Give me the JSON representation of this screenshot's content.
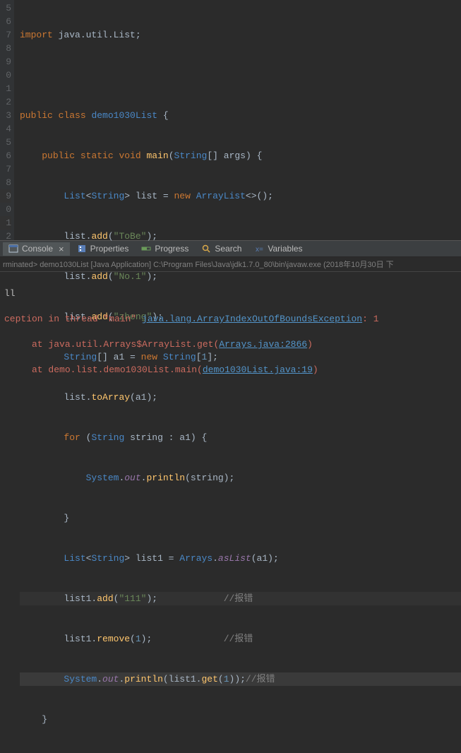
{
  "gutter": {
    "lines": [
      "5",
      "6",
      "7",
      "8",
      "9",
      "0",
      "1",
      "2",
      "3",
      "4",
      "5",
      "6",
      "7",
      "8",
      "9",
      "0",
      "1",
      "2"
    ],
    "breakpoint_line_index": 3
  },
  "code": {
    "l5": {
      "kw1": "import",
      "pkg": " java.util.List;"
    },
    "l7": {
      "kw1": "public",
      "kw2": "class",
      "name": "demo1030List",
      "brace": " {"
    },
    "l8": {
      "kw1": "public",
      "kw2": "static",
      "kw3": "void",
      "met": "main",
      "p1": "(",
      "cls": "String",
      "arr": "[] ",
      "arg": "args",
      "p2": ") {"
    },
    "l9": {
      "cls1": "List",
      "lt": "<",
      "cls2": "String",
      "gt": "> ",
      "var": "list = ",
      "kw": "new",
      "sp": " ",
      "cls3": "ArrayList",
      "diamond": "<>();"
    },
    "l10": {
      "obj": "list.",
      "met": "add",
      "p1": "(",
      "str": "\"ToBe\"",
      "p2": ");"
    },
    "l11": {
      "obj": "list.",
      "met": "add",
      "p1": "(",
      "str": "\"No.1\"",
      "p2": ");"
    },
    "l12": {
      "obj": "list.",
      "met": "add",
      "p1": "(",
      "str": "\"zheng\"",
      "p2": ");"
    },
    "l13": {
      "cls": "String",
      "arr": "[] ",
      "var": "a1 = ",
      "kw": "new",
      "sp": " ",
      "cls2": "String",
      "br1": "[",
      "num": "1",
      "br2": "];"
    },
    "l14": {
      "obj": "list.",
      "met": "toArray",
      "p": "(a1);"
    },
    "l15": {
      "kw": "for",
      "p1": " (",
      "cls": "String",
      "sp": " ",
      "var": "string : a1) {"
    },
    "l16": {
      "cls": "System",
      "dot1": ".",
      "fld": "out",
      "dot2": ".",
      "met": "println",
      "p": "(string);"
    },
    "l17": {
      "brace": "}"
    },
    "l18": {
      "cls1": "List",
      "lt": "<",
      "cls2": "String",
      "gt": "> ",
      "var": "list1 = ",
      "cls3": "Arrays",
      "dot": ".",
      "fld": "asList",
      "p": "(a1);"
    },
    "l19": {
      "obj": "list1.",
      "met": "add",
      "p1": "(",
      "str": "\"111\"",
      "p2": ");",
      "pad": "            ",
      "cmt": "//报错"
    },
    "l20": {
      "obj": "list1.",
      "met": "remove",
      "p1": "(",
      "num": "1",
      "p2": ");",
      "pad": "             ",
      "cmt": "//报错"
    },
    "l21": {
      "cls": "System",
      "dot1": ".",
      "fld": "out",
      "dot2": ".",
      "met": "println",
      "p1": "(list1.",
      "met2": "get",
      "p2": "(",
      "num": "1",
      "p3": "));",
      "cmt": "//报错"
    },
    "l22": {
      "brace": "}"
    }
  },
  "tabs": {
    "console": "Console",
    "properties": "Properties",
    "progress": "Progress",
    "search": "Search",
    "variables": "Variables"
  },
  "status": "rminated> demo1030List [Java Application] C:\\Program Files\\Java\\jdk1.7.0_80\\bin\\javaw.exe (2018年10月30日 下",
  "console": {
    "l1": "ll",
    "l2_pre": "ception in thread \"main\" ",
    "l2_link": "java.lang.ArrayIndexOutOfBoundsException",
    "l2_post": ": 1",
    "l3_pre": "     at java.util.Arrays$ArrayList.get(",
    "l3_link": "Arrays.java:2866",
    "l3_post": ")",
    "l4_pre": "     at demo.list.demo1030List.main(",
    "l4_link": "demo1030List.java:19",
    "l4_post": ")"
  }
}
